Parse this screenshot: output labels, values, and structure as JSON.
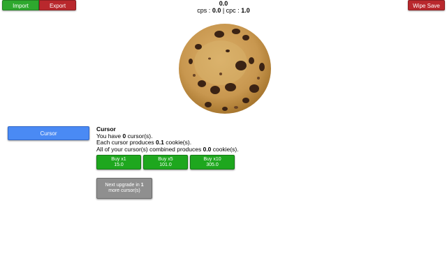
{
  "topbar": {
    "import_label": "Import",
    "export_label": "Export",
    "wipe_label": "Wipe Save"
  },
  "stats": {
    "cookies": "0.0",
    "cps_label": "cps : ",
    "cps_value": "0.0",
    "separator": " | ",
    "cpc_label": "cpc : ",
    "cpc_value": "1.0"
  },
  "cookie": {
    "icon": "cookie-icon"
  },
  "buildings": {
    "tabs": [
      {
        "label": "Cursor"
      }
    ]
  },
  "info": {
    "title": "Cursor",
    "owned_prefix": "You have ",
    "owned_value": "0",
    "owned_suffix": " cursor(s).",
    "each_prefix": "Each cursor produces ",
    "each_value": "0.1",
    "each_suffix": " cookie(s).",
    "combined_prefix": "All of your cursor(s) combined produces ",
    "combined_value": "0.0",
    "combined_suffix": " cookie(s)."
  },
  "buy_buttons": [
    {
      "label": "Buy x1",
      "price": "15.0"
    },
    {
      "label": "Buy x5",
      "price": "101.0"
    },
    {
      "label": "Buy x10",
      "price": "305.0"
    }
  ],
  "upgrade": {
    "prefix": "Next upgrade in ",
    "value": "1",
    "suffix": "more cursor(s)"
  },
  "colors": {
    "green": "#1ea71e",
    "red": "#b9282d",
    "blue": "#4a8af4",
    "gray": "#8f8f8f"
  }
}
